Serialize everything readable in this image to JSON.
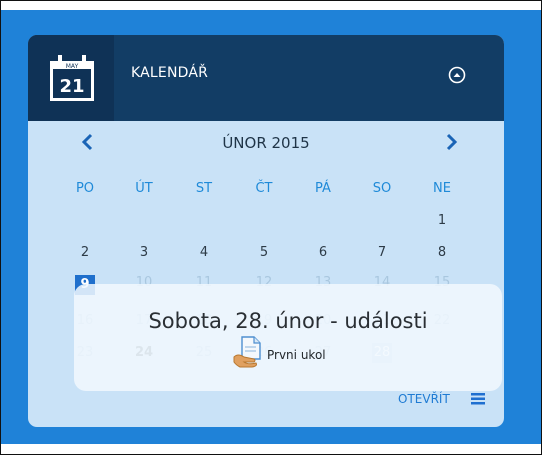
{
  "widget": {
    "icon_month": "MAY",
    "icon_day": "21",
    "title": "KALENDÁŘ"
  },
  "calendar": {
    "month_label": "ÚNOR 2015",
    "weekdays": [
      "PO",
      "ÚT",
      "ST",
      "ČT",
      "PÁ",
      "SO",
      "NE"
    ],
    "days": [
      "1",
      "2",
      "3",
      "4",
      "5",
      "6",
      "7",
      "8",
      "9",
      "10",
      "11",
      "12",
      "13",
      "14",
      "15",
      "16",
      "17",
      "18",
      "19",
      "20",
      "21",
      "22",
      "23",
      "24",
      "25",
      "26",
      "27",
      "28"
    ]
  },
  "popup": {
    "title": "Sobota, 28. únor - události",
    "event_label": "Prvni ukol"
  },
  "footer": {
    "open_label": "OTEVŘÍT"
  },
  "colors": {
    "background": "#1f82d8",
    "header": "#123d65",
    "panel": "#c9e2f7",
    "accent": "#1f8ad8"
  }
}
